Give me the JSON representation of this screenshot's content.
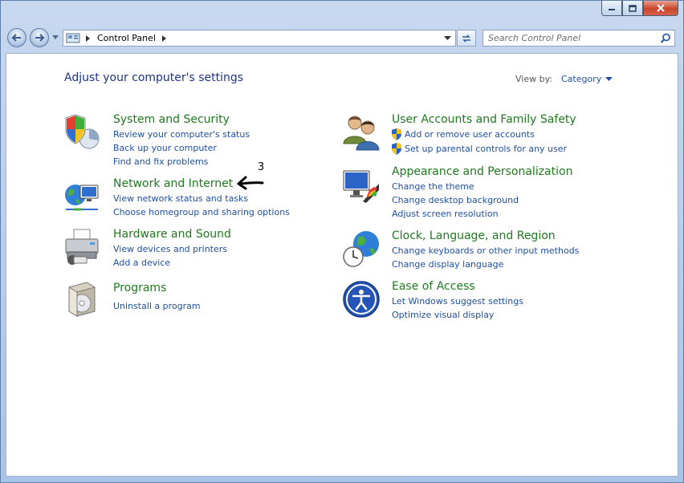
{
  "address": {
    "root_label": "Control Panel"
  },
  "search": {
    "placeholder": "Search Control Panel"
  },
  "main": {
    "headline": "Adjust your computer's settings",
    "view_by_label": "View by:",
    "view_by_value": "Category"
  },
  "categories": [
    {
      "title": "System and Security",
      "icon": "shield-icon",
      "links": [
        "Review your computer's status",
        "Back up your computer",
        "Find and fix problems"
      ]
    },
    {
      "title": "Network and Internet",
      "icon": "network-globe-icon",
      "links": [
        "View network status and tasks",
        "Choose homegroup and sharing options"
      ]
    },
    {
      "title": "Hardware and Sound",
      "icon": "printer-icon",
      "links": [
        "View devices and printers",
        "Add a device"
      ]
    },
    {
      "title": "Programs",
      "icon": "programs-box-icon",
      "links": [
        "Uninstall a program"
      ]
    },
    {
      "title": "User Accounts and Family Safety",
      "icon": "users-icon",
      "links": [
        "Add or remove user accounts",
        "Set up parental controls for any user"
      ]
    },
    {
      "title": "Appearance and Personalization",
      "icon": "monitor-palette-icon",
      "links": [
        "Change the theme",
        "Change desktop background",
        "Adjust screen resolution"
      ]
    },
    {
      "title": "Clock, Language, and Region",
      "icon": "clock-globe-icon",
      "links": [
        "Change keyboards or other input methods",
        "Change display language"
      ]
    },
    {
      "title": "Ease of Access",
      "icon": "ease-of-access-icon",
      "links": [
        "Let Windows suggest settings",
        "Optimize visual display"
      ]
    }
  ],
  "annotation": {
    "number": "3"
  },
  "colors": {
    "category_title": "#1f7a1f",
    "link": "#1e50a2",
    "headline": "#1e3287"
  }
}
